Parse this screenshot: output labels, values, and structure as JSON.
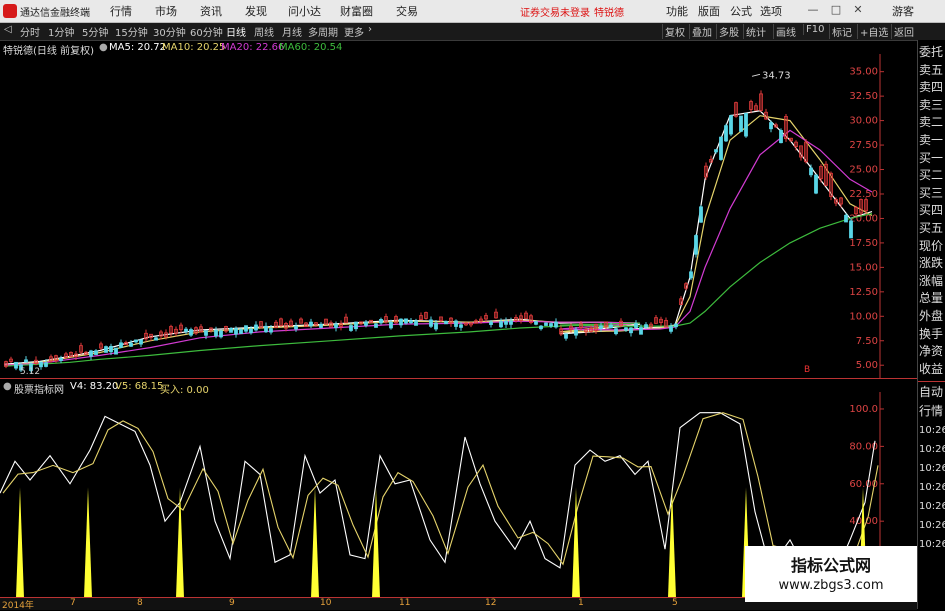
{
  "window": {
    "app_title": "通达信金融终端",
    "main_menu": [
      "行情",
      "市场",
      "资讯",
      "发现",
      "问小达",
      "财富圈",
      "交易"
    ],
    "login_notice": "证券交易未登录",
    "stock_short": "特锐德",
    "right_menu": [
      "功能",
      "版面",
      "公式",
      "选项"
    ],
    "guest": "游客",
    "close_icon": "close-icon"
  },
  "toolbar": {
    "periods": [
      "分时",
      "1分钟",
      "5分钟",
      "15分钟",
      "30分钟",
      "60分钟",
      "日线",
      "周线",
      "月线",
      "多周期",
      "更多"
    ],
    "active_period": "日线",
    "right_tools": [
      "复权",
      "叠加",
      "多股",
      "统计",
      "画线",
      "F10",
      "标记",
      "+自选",
      "返回"
    ]
  },
  "main_chart": {
    "stock_label": "特锐德(日线 前复权)",
    "ma5": "MA5: 20.72",
    "ma10": "MA10: 20.25",
    "ma20": "MA20: 22.66",
    "ma60": "MA60: 20.54",
    "high_label": "34.73",
    "low_label": "5.12",
    "marker_b": "B",
    "colors": {
      "ma5": "#ffffff",
      "ma10": "#e5d36b",
      "ma20": "#d23bd2",
      "ma60": "#3dbb3d",
      "up": "#e23b3b",
      "down": "#59d6e6"
    }
  },
  "indicator": {
    "title": "股票指标网",
    "v4": "V4: 83.20",
    "v5": "V5: 68.15",
    "buy": "买入: 0.00"
  },
  "right_panel": {
    "top_labels": [
      "委托",
      "卖五",
      "卖四",
      "卖三",
      "卖二",
      "卖一",
      "买一",
      "买二",
      "买三",
      "买四",
      "买五",
      "现价",
      "涨跌",
      "涨幅",
      "总量",
      "外盘",
      "换手",
      "净资",
      "收益"
    ],
    "bottom_labels": [
      "自动",
      "行情",
      "10:26",
      "10:26",
      "10:26",
      "10:26",
      "10:26",
      "10:26",
      "10:26"
    ]
  },
  "watermark": {
    "line1": "指标公式网",
    "line2": "www.zbgs3.com"
  },
  "x_axis": [
    "2014年",
    "7",
    "8",
    "9",
    "10",
    "11",
    "12",
    "1",
    "5",
    "6"
  ],
  "chart_data": {
    "type": "line",
    "price_axis": {
      "ticks": [
        "35.00",
        "32.50",
        "30.00",
        "27.50",
        "25.00",
        "22.50",
        "20.00",
        "17.50",
        "15.00",
        "12.50",
        "10.00",
        "7.50",
        "5.00"
      ]
    },
    "indicator_axis": {
      "ticks": [
        "100.0",
        "80.00",
        "60.00",
        "40.00"
      ]
    },
    "series": [
      {
        "name": "MA5",
        "values": [
          5.1,
          5.4,
          5.9,
          6.5,
          7.9,
          8.6,
          8.9,
          9.2,
          9.6,
          9.4,
          9.7,
          9.3,
          9.4,
          9.2,
          8.2,
          8.6,
          8.9,
          9.1,
          14,
          24,
          30.5,
          31,
          28,
          24,
          20,
          20.7
        ]
      },
      {
        "name": "MA10",
        "values": [
          5.0,
          5.3,
          5.8,
          6.3,
          7.5,
          8.4,
          8.8,
          9.1,
          9.5,
          9.4,
          9.6,
          9.4,
          9.4,
          9.3,
          8.4,
          8.5,
          8.8,
          9.0,
          12,
          20,
          28,
          30.5,
          30,
          26,
          21.5,
          20.3
        ]
      },
      {
        "name": "MA20",
        "values": [
          5.0,
          5.2,
          5.6,
          6.0,
          6.8,
          7.8,
          8.4,
          8.8,
          9.2,
          9.3,
          9.5,
          9.4,
          9.4,
          9.3,
          8.7,
          8.6,
          8.7,
          8.9,
          10.5,
          15,
          21,
          26.5,
          29,
          27,
          24,
          22.7
        ]
      },
      {
        "name": "MA60",
        "values": [
          4.9,
          5.1,
          5.3,
          5.6,
          6.0,
          6.5,
          7.0,
          7.5,
          8.0,
          8.4,
          8.8,
          9.0,
          9.2,
          9.3,
          9.1,
          9.0,
          9.0,
          9.0,
          9.3,
          10.5,
          13,
          15.5,
          17.5,
          19,
          20,
          20.5
        ]
      }
    ]
  }
}
